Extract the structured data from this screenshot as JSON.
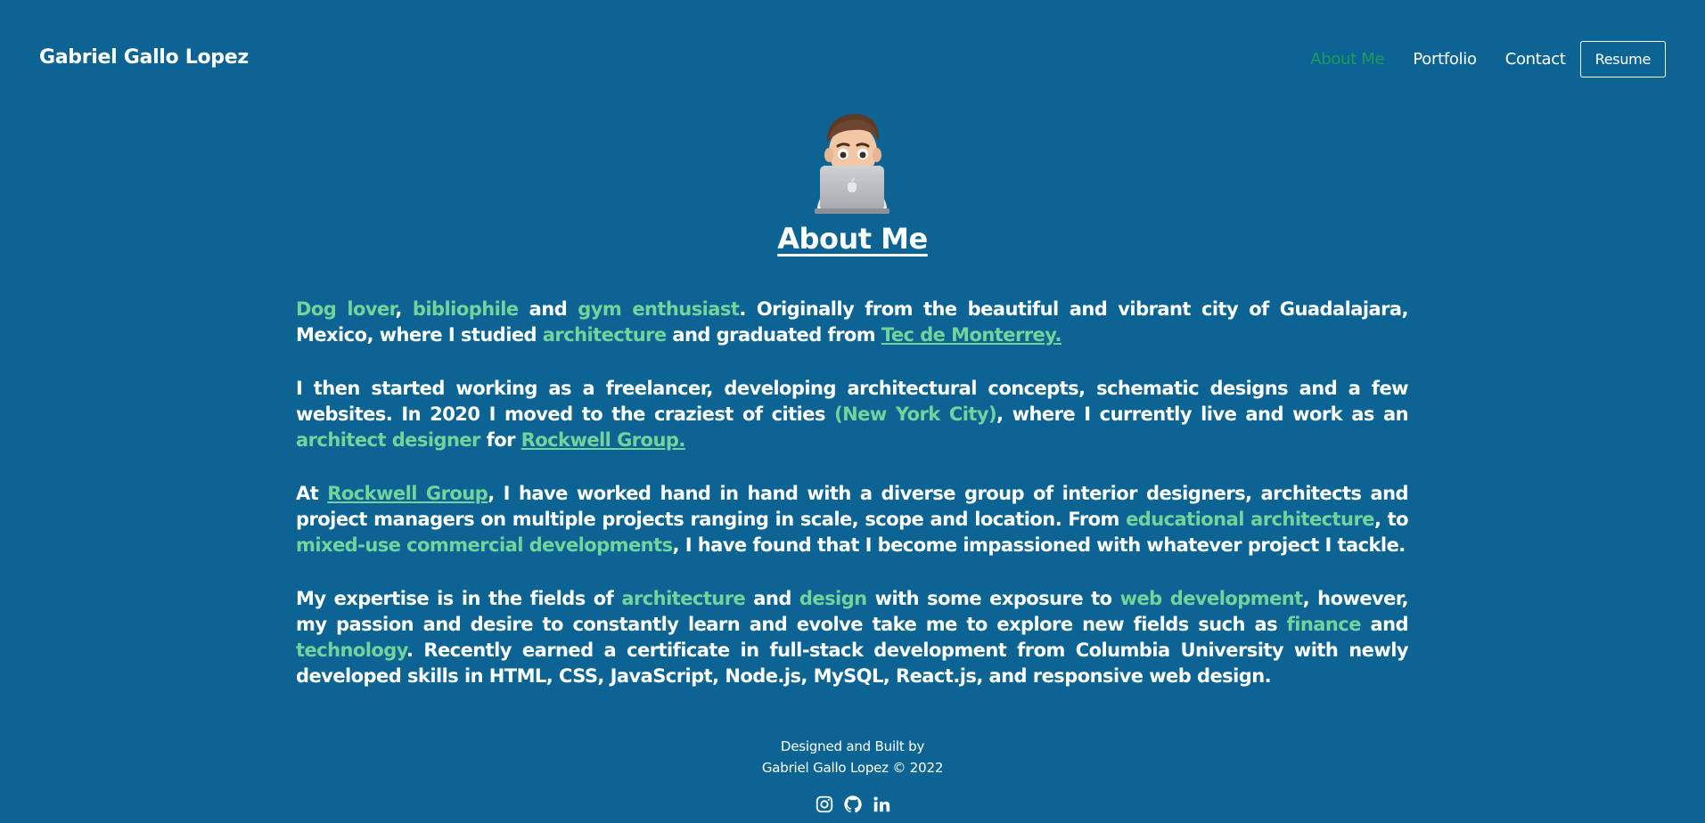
{
  "nav": {
    "brand": "Gabriel Gallo Lopez",
    "links": [
      "About Me",
      "Portfolio",
      "Contact"
    ],
    "resume": "Resume"
  },
  "main": {
    "title": "About Me",
    "p1": {
      "a": "Dog lover",
      "b": ", ",
      "c": "bibliophile",
      "d": " and ",
      "e": "gym enthusiast",
      "f": ". Originally from the beautiful and vibrant city of Guadalajara, Mexico, where I studied ",
      "g": "architecture",
      "h": " and graduated from ",
      "i": "Tec de Monterrey."
    },
    "p2": {
      "a": "I then started working as a freelancer, developing architectural concepts, schematic designs and a few websites. In 2020 I moved to the craziest of cities ",
      "b": "(New York City)",
      "c": ", where I currently live and work as an ",
      "d": "architect designer",
      "e": " for ",
      "f": "Rockwell Group."
    },
    "p3": {
      "a": "At ",
      "b": "Rockwell Group",
      "c": ", I have worked hand in hand with a diverse group of interior designers, architects and project managers on multiple projects ranging in scale, scope and location. From ",
      "d": "educational architecture",
      "e": ", to ",
      "f": "mixed-use commercial developments",
      "g": ", I have found that I become impassioned with whatever project I tackle."
    },
    "p4": {
      "a": "My expertise is in the fields of ",
      "b": "architecture",
      "c": " and ",
      "d": "design",
      "e": " with some exposure to ",
      "f": "web development",
      "g": ", however, my passion and desire to constantly learn and evolve take me to explore new fields such as ",
      "h": "finance",
      "i": " and ",
      "j": "technology",
      "k": ". Recently earned a certificate in full-stack development from Columbia University with newly developed skills in HTML, CSS, JavaScript, Node.js, MySQL, React.js, and responsive web design."
    }
  },
  "footer": {
    "line1": "Designed and Built by",
    "line2": "Gabriel Gallo Lopez © 2022",
    "icons": [
      "instagram-icon",
      "github-icon",
      "linkedin-icon"
    ]
  },
  "colors": {
    "background": "#0c6494",
    "highlight": "#72d49a",
    "active_nav": "#1d9a5c",
    "text": "#ffffff"
  }
}
